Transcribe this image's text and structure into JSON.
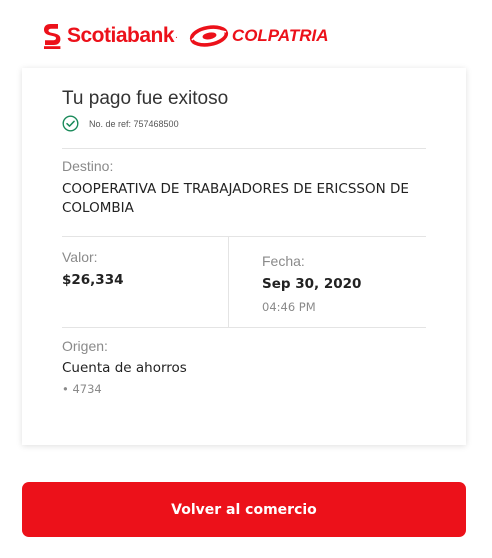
{
  "header": {
    "scotiabank_logo_text": "Scotiabank",
    "scotiabank_logo_suffix": ".",
    "colpatria_logo_text": "COLPATRIA",
    "brand_color": "#ec111a"
  },
  "receipt": {
    "title": "Tu pago fue exitoso",
    "reference": "No. de ref: 757468500",
    "status_icon": "check-circle-icon",
    "status_color": "#1a8a5a",
    "destino": {
      "label": "Destino:",
      "value": "COOPERATIVA DE TRABAJADORES DE ERICSSON DE COLOMBIA"
    },
    "valor": {
      "label": "Valor:",
      "value": "$26,334"
    },
    "fecha": {
      "label": "Fecha:",
      "date": "Sep 30, 2020",
      "time": "04:46 PM"
    },
    "origen": {
      "label": "Origen:",
      "account_type": "Cuenta de ahorros",
      "account_number": "• 4734"
    }
  },
  "actions": {
    "return_label": "Volver al comercio"
  }
}
